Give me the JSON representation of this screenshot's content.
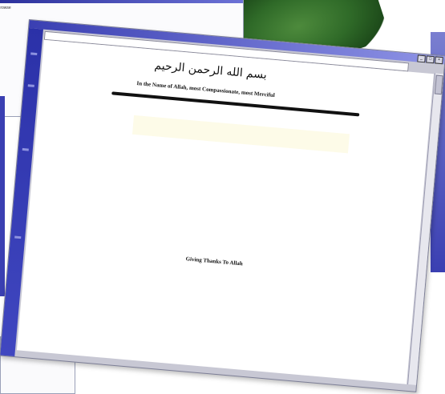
{
  "bg_window": {
    "title": "Browse",
    "tree_items": [
      "",
      "",
      "",
      "",
      "",
      ""
    ]
  },
  "main_window": {
    "title": "",
    "address": ""
  },
  "page": {
    "arabic_heading": "بسم الله الرحمن الرحيم",
    "english_heading": "In the Name of Allah, most Compassionate, most Merciful",
    "article_title": "Giving Thanks To Allah",
    "article_author": "",
    "paragraphs": [
      "",
      ""
    ]
  },
  "colors": {
    "title_blue": "#3a3fb2",
    "sidebar_blue": "#2b31a8",
    "leaf_green": "#2f6a28"
  }
}
